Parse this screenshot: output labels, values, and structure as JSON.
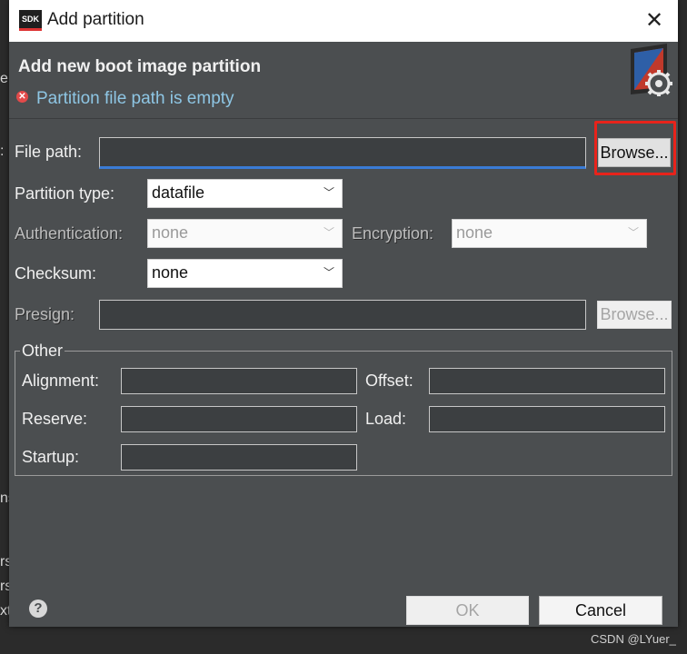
{
  "window": {
    "title": "Add partition",
    "logo_text": "SDK"
  },
  "header": {
    "title": "Add new boot image partition",
    "error": "Partition file path is empty"
  },
  "form": {
    "file_path": {
      "label": "File path:",
      "value": "",
      "browse_label": "Browse..."
    },
    "partition_type": {
      "label": "Partition type:",
      "value": "datafile"
    },
    "authentication": {
      "label": "Authentication:",
      "value": "none"
    },
    "encryption": {
      "label": "Encryption:",
      "value": "none"
    },
    "checksum": {
      "label": "Checksum:",
      "value": "none"
    },
    "presign": {
      "label": "Presign:",
      "value": "",
      "browse_label": "Browse..."
    }
  },
  "other": {
    "title": "Other",
    "alignment": {
      "label": "Alignment:",
      "value": ""
    },
    "offset": {
      "label": "Offset:",
      "value": ""
    },
    "reserve": {
      "label": "Reserve:",
      "value": ""
    },
    "load": {
      "label": "Load:",
      "value": ""
    },
    "startup": {
      "label": "Startup:",
      "value": ""
    }
  },
  "footer": {
    "help": "?",
    "ok_label": "OK",
    "cancel_label": "Cancel"
  },
  "background_fragments": [
    "e",
    ":",
    "ns",
    "rs",
    "rs",
    "xt"
  ],
  "watermark": "CSDN @LYuer_",
  "colors": {
    "highlight_box": "#e8231b",
    "error_text": "#8ec6e4",
    "focus_underline": "#3a7bd5"
  },
  "icons": {
    "close": "close-icon",
    "error": "error-icon",
    "gear": "gear-icon",
    "chevron": "chevron-down-icon",
    "help": "help-icon"
  }
}
